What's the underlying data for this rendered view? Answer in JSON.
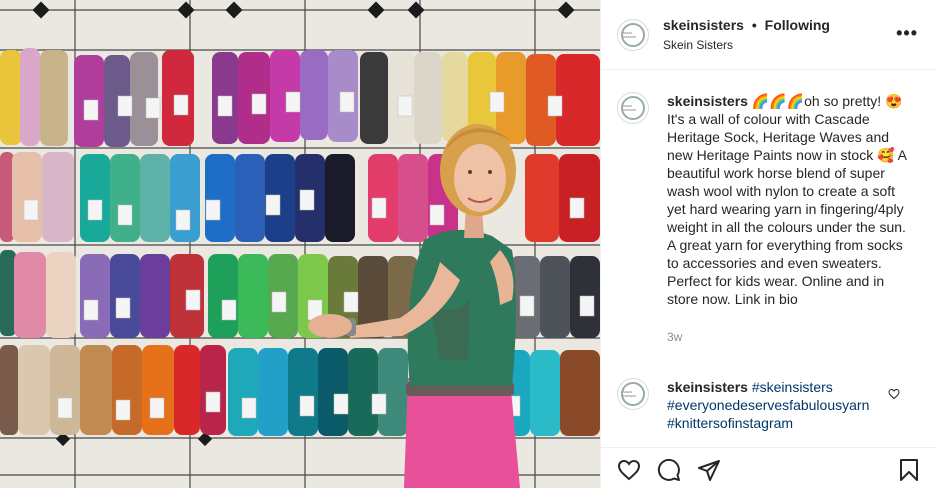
{
  "header": {
    "username": "skeinsisters",
    "separator": "•",
    "follow_status": "Following",
    "location": "Skein Sisters",
    "more_label": "•••",
    "avatar_text": "SKEIN SISTERS"
  },
  "caption": {
    "username": "skeinsisters",
    "text": " 🌈🌈🌈oh so pretty! 😍 It's a wall of colour with Cascade Heritage Sock, Heritage Waves and new Heritage Paints now in stock 🥰 A beautiful work horse blend of super wash wool with nylon to create a soft yet hard wearing yarn in fingering/4ply weight in all the colours under the sun. A great yarn for everything from socks to accessories and even sweaters. Perfect for kids wear. Online and in store now. Link in bio",
    "time": "3w"
  },
  "comment": {
    "username": "skeinsisters",
    "tag1": "#skeinsisters",
    "tag2": "#everyonedeservesfabulousyarn",
    "tag3": "#knittersofinstagram"
  },
  "icons": {
    "like": "heart-icon",
    "comment": "comment-icon",
    "share": "share-icon",
    "save": "bookmark-icon"
  }
}
